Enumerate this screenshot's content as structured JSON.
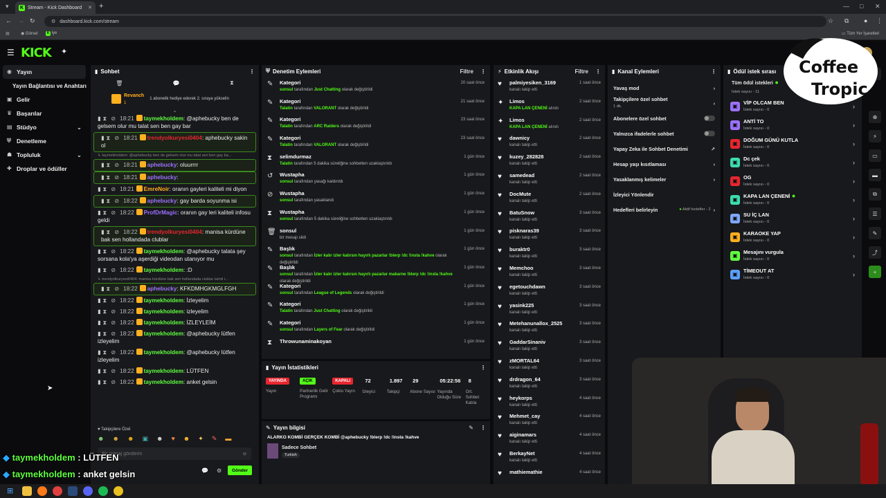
{
  "browser": {
    "tab_title": "Stream - Kick Dashboard",
    "url": "dashboard.kick.com/stream",
    "bookmarks": [
      "Görsel",
      "iye"
    ],
    "all_bookmarks": "Tüm Yer İşaretleri"
  },
  "sidebar": {
    "items": [
      {
        "label": "Yayın",
        "icon": "broadcast-icon"
      },
      {
        "label": "Yayın Bağlantısı ve Anahtarı",
        "icon": ""
      },
      {
        "label": "Gelir",
        "icon": "wallet-icon"
      },
      {
        "label": "Başarılar",
        "icon": "trophy-icon"
      },
      {
        "label": "Stüdyo",
        "icon": "studio-icon"
      },
      {
        "label": "Denetleme",
        "icon": "shield-icon"
      },
      {
        "label": "Topluluk",
        "icon": "people-icon"
      },
      {
        "label": "Droplar ve ödüller",
        "icon": "gift-icon"
      }
    ]
  },
  "chat": {
    "title": "Sohbet",
    "pinned_user": "Revanch",
    "pinned_count": "1",
    "pinned_text": "1 abonelik hediye ederek 2. sıraya yükselin",
    "messages": [
      {
        "t": "18:21",
        "u": "taymekholdem",
        "c": "u1",
        "m": ": @aphebucky ben de gelsem olur mu talat sen ben gay bar",
        "hl": false
      },
      {
        "t": "18:21",
        "u": "trendyolkuryesi0404",
        "c": "u2",
        "m": ": aphebucky sakin ol",
        "hl": true
      },
      {
        "t": "",
        "u": "",
        "c": "",
        "m": "↳ taymekholdem: @aphebucky ben de gelsem olur mu talat sen ben gay ba...",
        "hl": false,
        "rep": true
      },
      {
        "t": "18:21",
        "u": "aphebucky",
        "c": "u3",
        "m": ": oluurrrr",
        "hl": true
      },
      {
        "t": "18:21",
        "u": "aphebucky",
        "c": "u3",
        "m": ":",
        "hl": true
      },
      {
        "t": "18:21",
        "u": "EmreNoir",
        "c": "u4",
        "m": ": oranın gayleri kaliteli mi diyon",
        "hl": false
      },
      {
        "t": "18:22",
        "u": "aphebucky",
        "c": "u3",
        "m": ": gay barda soyunma isi",
        "hl": true
      },
      {
        "t": "18:22",
        "u": "ProfDrMagic",
        "c": "u3",
        "m": ": oranın gay leri kaliteli infosu geldi",
        "hl": false
      },
      {
        "t": "18:22",
        "u": "trendyolkuryesi0404",
        "c": "u2",
        "m": ": manisa kürdüne bak sen hollandada clublar",
        "hl": true
      },
      {
        "t": "18:22",
        "u": "taymekholdem",
        "c": "u1",
        "m": ": @aphebucky talata şey sorsana kola'ya aşerdiği videodan utanıyor mu",
        "hl": false
      },
      {
        "t": "18:22",
        "u": "taymekholdem",
        "c": "u1",
        "m": ": :D",
        "hl": false
      },
      {
        "t": "",
        "u": "",
        "c": "",
        "m": "↳ trendyolkuryesi0404: manisa kürdüne bak sen hollandada clublar isimli i...",
        "hl": false,
        "rep": true
      },
      {
        "t": "18:22",
        "u": "aphebucky",
        "c": "u3",
        "m": ": KFKDMHGKMGLFGH",
        "hl": true
      },
      {
        "t": "18:22",
        "u": "taymekholdem",
        "c": "u1",
        "m": ": İzleyelim",
        "hl": false
      },
      {
        "t": "18:22",
        "u": "taymekholdem",
        "c": "u1",
        "m": ": izleyelim",
        "hl": false
      },
      {
        "t": "18:22",
        "u": "taymekholdem",
        "c": "u1",
        "m": ": İZLEYLEİM",
        "hl": false
      },
      {
        "t": "18:22",
        "u": "taymekholdem",
        "c": "u1",
        "m": ": @aphebucky lütfen izleyelim",
        "hl": false
      },
      {
        "t": "18:22",
        "u": "taymekholdem",
        "c": "u1",
        "m": ": @aphebucky lütfen izleyelim",
        "hl": false
      },
      {
        "t": "18:22",
        "u": "taymekholdem",
        "c": "u1",
        "m": ": LÜTFEN",
        "hl": false
      },
      {
        "t": "18:22",
        "u": "taymekholdem",
        "c": "u1",
        "m": ": anket gelsin",
        "hl": false
      }
    ],
    "followers_only": "Takipçilere Özel",
    "input_placeholder": "Bir mesaj gönderin",
    "send_label": "Gönder"
  },
  "mod": {
    "title": "Denetim Eylemleri",
    "filter": "Filtre",
    "items": [
      {
        "ic": "✎",
        "t": "Kategori",
        "u": "sonsul",
        "a": "tarafından",
        "g": "Just Chatting",
        "e": "olarak değiştirildi",
        "tm": "20 saat önce"
      },
      {
        "ic": "✎",
        "t": "Kategori",
        "u": "Talatin",
        "a": "tarafından",
        "g": "VALORANT",
        "e": "olarak değiştirildi",
        "tm": "21 saat önce"
      },
      {
        "ic": "✎",
        "t": "Kategori",
        "u": "Talatin",
        "a": "tarafından",
        "g": "ARC Raiders",
        "e": "olarak değiştirildi",
        "tm": "23 saat önce"
      },
      {
        "ic": "✎",
        "t": "Kategori",
        "u": "Talatin",
        "a": "tarafından",
        "g": "VALORANT",
        "e": "olarak değiştirildi",
        "tm": "23 saat önce"
      },
      {
        "ic": "⧗",
        "t": "selimdurmaz",
        "u": "Talatin",
        "a": "tarafından 5 dakika süreliğine sohbetten uzaklaştırıldı",
        "g": "",
        "e": "",
        "tm": "1 gün önce"
      },
      {
        "ic": "↺",
        "t": "Wustapha",
        "u": "sonsul",
        "a": "tarafından yasağı kaldırıldı",
        "g": "",
        "e": "",
        "tm": "1 gün önce"
      },
      {
        "ic": "⊘",
        "t": "Wustapha",
        "u": "sonsul",
        "a": "tarafından yasaklandı",
        "g": "",
        "e": "",
        "tm": "1 gün önce"
      },
      {
        "ic": "⧗",
        "t": "Wustapha",
        "u": "sonsul",
        "a": "tarafından 5 dakika süreliğine sohbetten uzaklaştırıldı",
        "g": "",
        "e": "",
        "tm": "1 gün önce"
      },
      {
        "ic": "🗑",
        "t": "sonsul",
        "u": "",
        "a": "bir mesajı sildi",
        "g": "",
        "e": "",
        "tm": "1 gün önce"
      },
      {
        "ic": "✎",
        "t": "Başlık",
        "u": "sonsul",
        "a": "tarafından",
        "g": "İzler kalır izler kalırsın hayırlı pazarlar !blerp !dc !insta !kahve",
        "e": "olarak değiştirildi",
        "tm": "1 gün önce"
      },
      {
        "ic": "✎",
        "t": "Başlık",
        "u": "sonsul",
        "a": "tarafından",
        "g": "İzler kalır izler kalırsın hayırlı pazarlar makarne !blerp !dc !insta !kahve",
        "e": "olarak değiştirildi",
        "tm": "1 gün önce"
      },
      {
        "ic": "✎",
        "t": "Kategori",
        "u": "sonsul",
        "a": "tarafından",
        "g": "League of Legends",
        "e": "olarak değiştirildi",
        "tm": "1 gün önce"
      },
      {
        "ic": "✎",
        "t": "Kategori",
        "u": "Talatin",
        "a": "tarafından",
        "g": "Just Chatting",
        "e": "olarak değiştirildi",
        "tm": "1 gün önce"
      },
      {
        "ic": "✎",
        "t": "Kategori",
        "u": "sonsul",
        "a": "tarafından",
        "g": "Layers of Fear",
        "e": "olarak değiştirildi",
        "tm": "1 gün önce"
      },
      {
        "ic": "⧗",
        "t": "Throwunaminakoyan",
        "u": "",
        "a": "",
        "g": "",
        "e": "",
        "tm": "1 gün önce"
      }
    ]
  },
  "stats": {
    "title": "Yayın İstatistikleri",
    "items": [
      {
        "badge": "YAYINDA",
        "label": "Yayın",
        "kind": "red"
      },
      {
        "badge": "AÇIK",
        "label": "Partnerlik Gelir Programı",
        "kind": "green"
      },
      {
        "badge": "KAPALI",
        "label": "Çoklu Yayın",
        "kind": "red"
      },
      {
        "badge": "72",
        "label": "İzleyici",
        "kind": "num"
      },
      {
        "badge": "1.897",
        "label": "Takipçi",
        "kind": "num"
      },
      {
        "badge": "29",
        "label": "Abone Sayısı",
        "kind": "num"
      },
      {
        "badge": "05:22:56",
        "label": "Yayında Olduğu Süre",
        "kind": "num"
      },
      {
        "badge": "8",
        "label": "Ort. Sohbet Katıla",
        "kind": "num"
      }
    ]
  },
  "info": {
    "title": "Yayın bilgisi",
    "stream_title": "ALARKO KOMBİ GERÇEK KOMBİ @aphebucky !blerp !dc !insta !kahve",
    "category": "Sadece Sohbet",
    "tag": "Turkish"
  },
  "activity": {
    "title": "Etkinlik Akışı",
    "filter": "Filtre",
    "items": [
      {
        "ic": "♥",
        "n": "palmiyesiken_3169",
        "d": "kanalı takip etti",
        "tm": "1 saat önce"
      },
      {
        "ic": "✦",
        "n": "Limos",
        "d": "KAPA LAN ÇENENİ",
        "d2": "alındı",
        "tm": "2 saat önce"
      },
      {
        "ic": "✦",
        "n": "Limos",
        "d": "KAPA LAN ÇENENİ",
        "d2": "alındı",
        "tm": "2 saat önce"
      },
      {
        "ic": "♥",
        "n": "dawnicy",
        "d": "kanalı takip etti",
        "tm": "2 saat önce"
      },
      {
        "ic": "♥",
        "n": "kuzey_282828",
        "d": "kanalı takip etti",
        "tm": "2 saat önce"
      },
      {
        "ic": "♥",
        "n": "samedead",
        "d": "kanalı takip etti",
        "tm": "2 saat önce"
      },
      {
        "ic": "♥",
        "n": "DocMute",
        "d": "kanalı takip etti",
        "tm": "2 saat önce"
      },
      {
        "ic": "♥",
        "n": "BatuSnow",
        "d": "kanalı takip etti",
        "tm": "3 saat önce"
      },
      {
        "ic": "♥",
        "n": "pisknaras39",
        "d": "kanalı takip etti",
        "tm": "3 saat önce"
      },
      {
        "ic": "♥",
        "n": "buraktr0",
        "d": "kanalı takip etti",
        "tm": "3 saat önce"
      },
      {
        "ic": "♥",
        "n": "Memchoo",
        "d": "kanalı takip etti",
        "tm": "3 saat önce"
      },
      {
        "ic": "♥",
        "n": "egetouchdawn",
        "d": "kanalı takip etti",
        "tm": "3 saat önce"
      },
      {
        "ic": "♥",
        "n": "yasink225",
        "d": "kanalı takip etti",
        "tm": "3 saat önce"
      },
      {
        "ic": "♥",
        "n": "Metehanunallox_2525",
        "d": "kanalı takip etti",
        "tm": "3 saat önce"
      },
      {
        "ic": "♥",
        "n": "GaddarSinaniv",
        "d": "kanalı takip etti",
        "tm": "3 saat önce"
      },
      {
        "ic": "♥",
        "n": "zMORTAL64",
        "d": "kanalı takip etti",
        "tm": "3 saat önce"
      },
      {
        "ic": "♥",
        "n": "drdragon_64",
        "d": "kanalı takip etti",
        "tm": "3 saat önce"
      },
      {
        "ic": "♥",
        "n": "heykorps",
        "d": "kanalı takip etti",
        "tm": "4 saat önce"
      },
      {
        "ic": "♥",
        "n": "Mehmet_cay",
        "d": "kanalı takip etti",
        "tm": "4 saat önce"
      },
      {
        "ic": "♥",
        "n": "aiginamars",
        "d": "kanalı takip etti",
        "tm": "4 saat önce"
      },
      {
        "ic": "♥",
        "n": "BerkayNet",
        "d": "kanalı takip etti",
        "tm": "4 saat önce"
      },
      {
        "ic": "♥",
        "n": "mathiemathie",
        "d": "",
        "tm": "4 saat önce"
      }
    ]
  },
  "channel": {
    "title": "Kanal Eylemleri",
    "items": [
      {
        "l": "Yavaş mod",
        "r": "›",
        "sub": ""
      },
      {
        "l": "Takipçilere özel sohbet",
        "r": "›",
        "sub": "1 dk."
      },
      {
        "l": "Abonelere özel sohbet",
        "r": "toggle",
        "sub": ""
      },
      {
        "l": "Yalnızca ifadelerle sohbet",
        "r": "toggle",
        "sub": ""
      },
      {
        "l": "Yapay Zeka ile Sohbet Denetimi",
        "r": "↗",
        "sub": ""
      },
      {
        "l": "Hesap yaşı kısıtlaması",
        "r": "›",
        "sub": ""
      },
      {
        "l": "Yasaklanmış kelimeler",
        "r": "›",
        "sub": ""
      },
      {
        "l": "İzleyici Yönlendir",
        "r": "",
        "sub": ""
      },
      {
        "l": "Hedefleri belirleyin",
        "r": "›",
        "sub": "",
        "extra": "Aktif hedefler - 2"
      }
    ]
  },
  "rewards": {
    "title": "Ödül istek sırası",
    "all": "Tüm ödül istekleri",
    "all_count": "İstek sayısı - 11",
    "items": [
      {
        "n": "VİP OLCAM BEN",
        "c": "İstek sayısı - 0",
        "col": "#9b71ff",
        "dot": false
      },
      {
        "n": "ANTİ TO",
        "c": "İstek sayısı - 0",
        "col": "#9b71ff",
        "dot": false
      },
      {
        "n": "DOĞUM GÜNÜ KUTLA",
        "c": "İstek sayısı - 0",
        "col": "#e8262f",
        "dot": false
      },
      {
        "n": "Dc çek",
        "c": "İstek sayısı - 0",
        "col": "#3cdcb0",
        "dot": false
      },
      {
        "n": "OG",
        "c": "İstek sayısı - 0",
        "col": "#e8262f",
        "dot": false
      },
      {
        "n": "KAPA LAN ÇENENİ",
        "c": "İstek sayısı - 0",
        "col": "#3cdcb0",
        "dot": true
      },
      {
        "n": "SU İÇ LAN",
        "c": "İstek sayısı - 0",
        "col": "#7fa8ff",
        "dot": false
      },
      {
        "n": "KARAOKE YAP",
        "c": "İstek sayısı - 0",
        "col": "#ffb020",
        "dot": false
      },
      {
        "n": "Mesajını vurgula",
        "c": "İstek sayısı - 0",
        "col": "#61ff42",
        "dot": false
      },
      {
        "n": "TİMEOUT AT",
        "c": "İstek sayısı - 0",
        "col": "#5aa0ff",
        "dot": false
      }
    ]
  },
  "overlay": {
    "lines": [
      {
        "u": "taymekholdem",
        "m": " : LÜTFEN"
      },
      {
        "u": "taymekholdem",
        "m": " : anket gelsin"
      }
    ],
    "brand_1": "Coffee",
    "brand_2": "Tropic"
  }
}
